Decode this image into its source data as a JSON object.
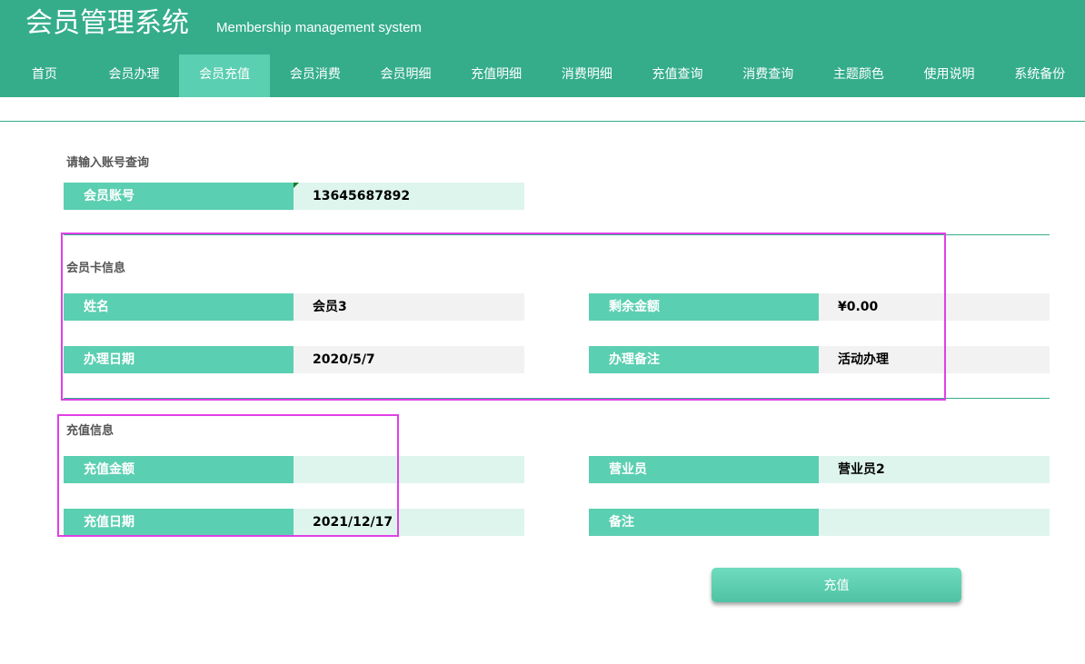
{
  "header": {
    "title": "会员管理系统",
    "subtitle": "Membership management system"
  },
  "nav": {
    "items": [
      "首页",
      "会员办理",
      "会员充值",
      "会员消费",
      "会员明细",
      "充值明细",
      "消费明细",
      "充值查询",
      "消费查询",
      "主题颜色",
      "使用说明",
      "系统备份"
    ],
    "active": "会员充值"
  },
  "query": {
    "section_title": "请输入账号查询",
    "account_label": "会员账号",
    "account_value": "13645687892"
  },
  "card_info": {
    "section_title": "会员卡信息",
    "name_label": "姓名",
    "name_value": "会员3",
    "balance_label": "剩余金额",
    "balance_value": "¥0.00",
    "date_label": "办理日期",
    "date_value": "2020/5/7",
    "remark_label": "办理备注",
    "remark_value": "活动办理"
  },
  "recharge_info": {
    "section_title": "充值信息",
    "amount_label": "充值金额",
    "amount_value": "",
    "clerk_label": "营业员",
    "clerk_value": "营业员2",
    "date_label": "充值日期",
    "date_value": "2021/12/17",
    "note_label": "备注",
    "note_value": ""
  },
  "actions": {
    "recharge_label": "充值"
  },
  "colors": {
    "header": "#35ad8b",
    "accent": "#5bcfb1",
    "value_gray": "#f2f2f2",
    "value_mint": "#def5ee",
    "highlight": "#e040e6"
  }
}
